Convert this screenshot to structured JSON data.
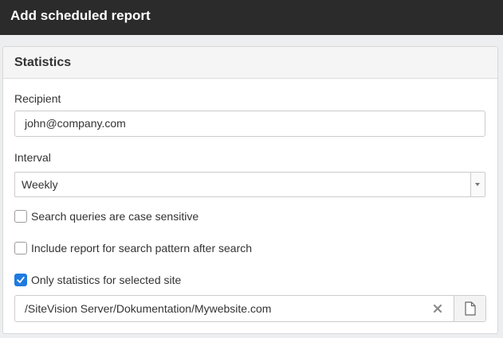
{
  "window": {
    "title": "Add scheduled report"
  },
  "panel": {
    "title": "Statistics",
    "recipient": {
      "label": "Recipient",
      "value": "john@company.com"
    },
    "interval": {
      "label": "Interval",
      "selected": "Weekly"
    },
    "options": [
      {
        "label": "Search queries are case sensitive",
        "checked": false
      },
      {
        "label": "Include report for search pattern after search",
        "checked": false
      },
      {
        "label": "Only statistics for selected site",
        "checked": true
      }
    ],
    "site": {
      "value": "/SiteVision Server/Dokumentation/Mywebsite.com"
    }
  },
  "colors": {
    "titlebar": "#2b2b2b",
    "checkbox_checked": "#1f7ae0"
  },
  "icons": {
    "clear": "close-icon",
    "browse": "document-icon",
    "dropdown": "chevron-down-icon",
    "check": "checkmark-icon"
  }
}
